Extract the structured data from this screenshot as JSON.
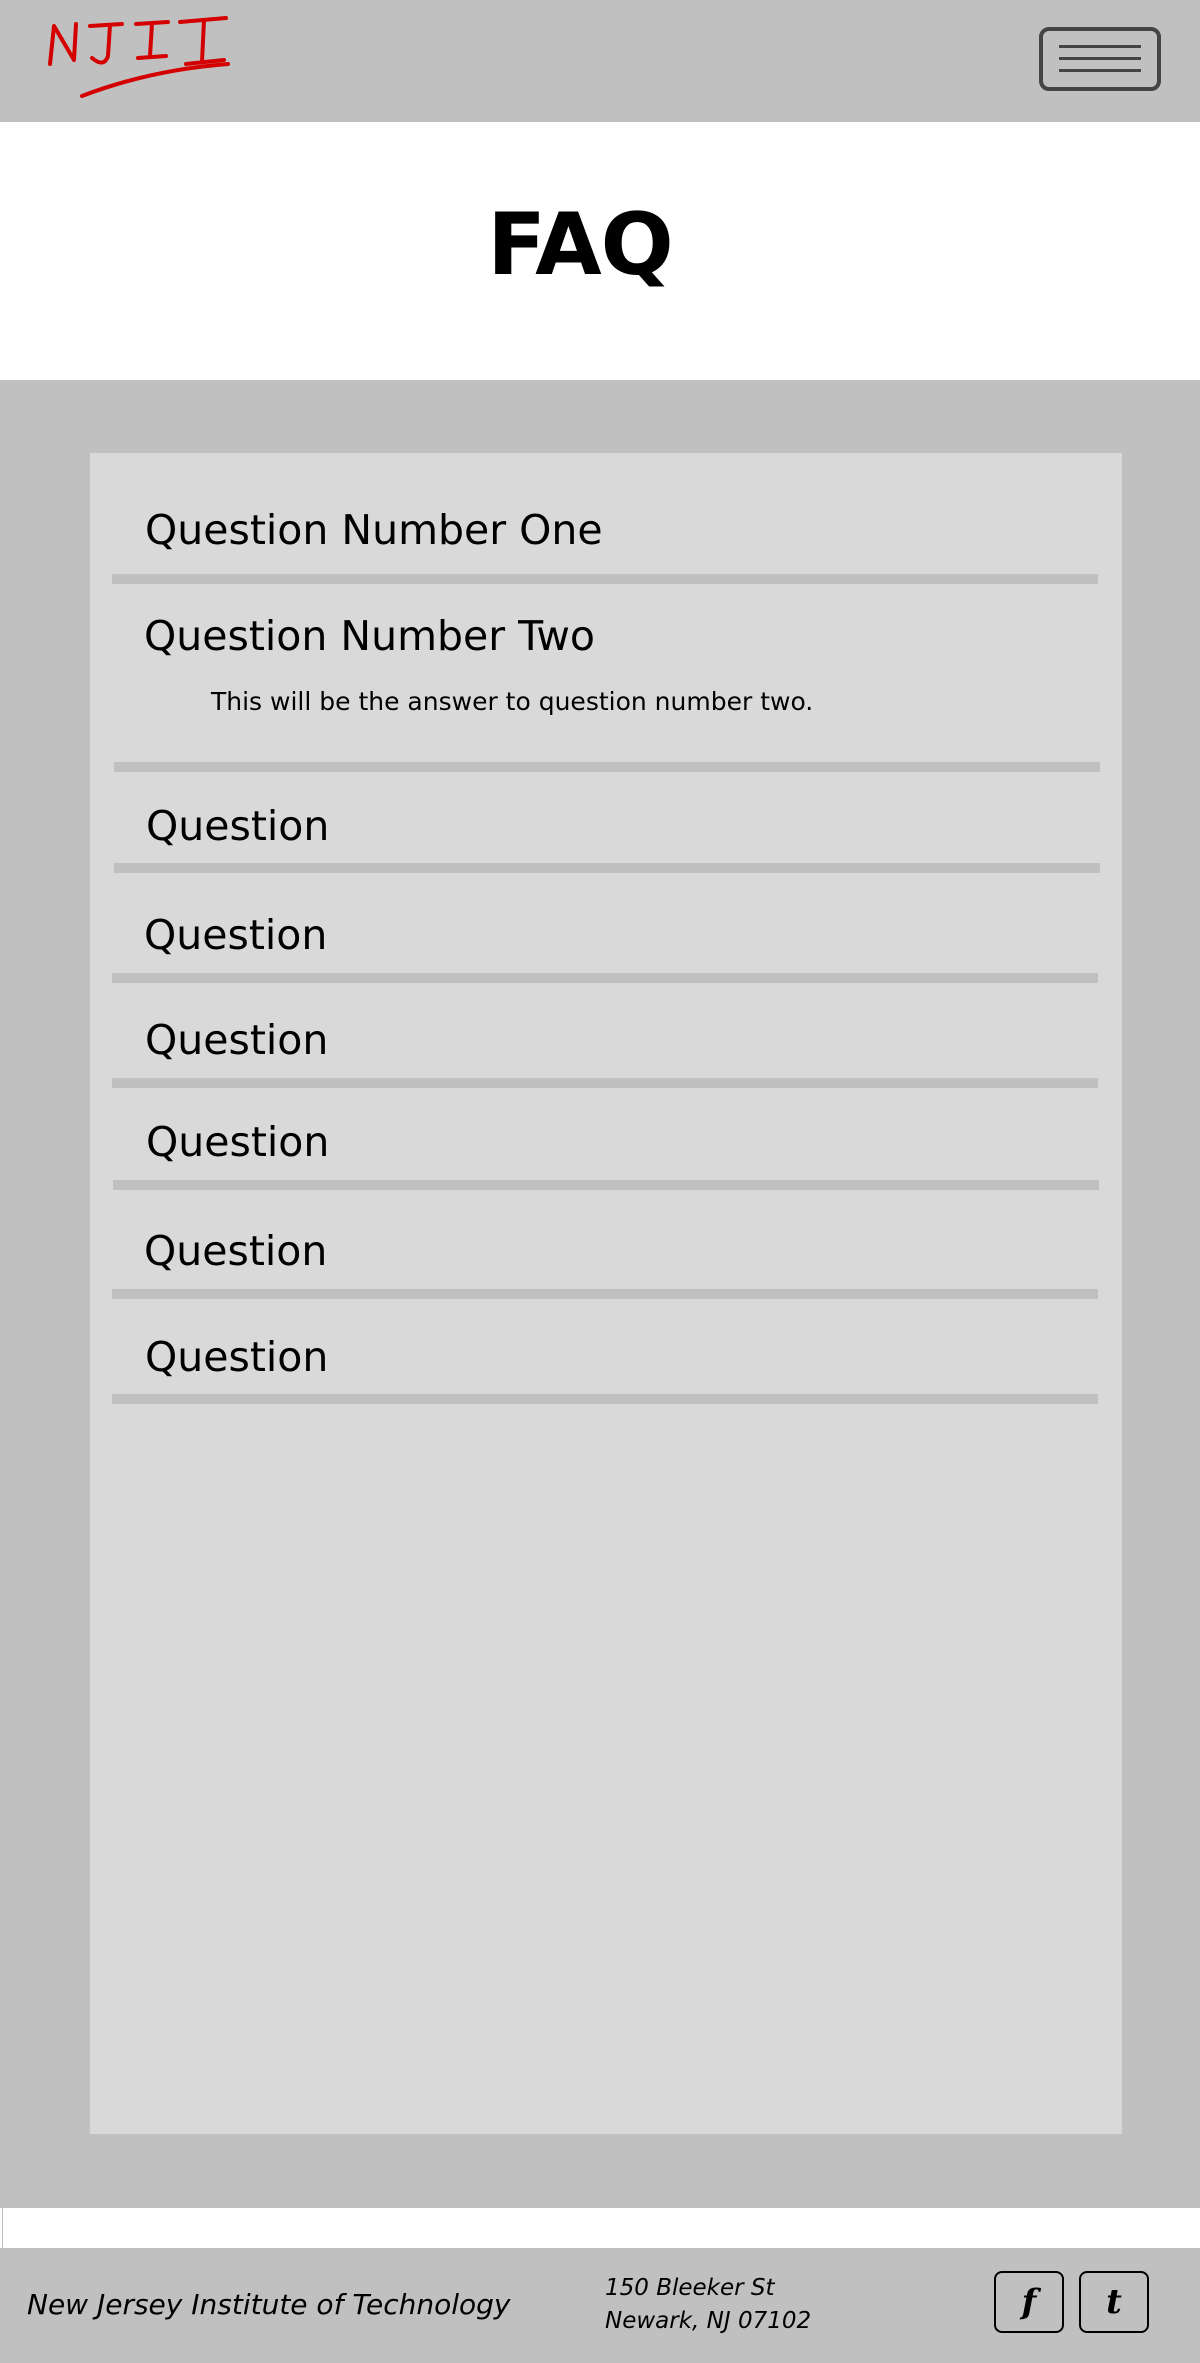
{
  "header": {
    "logo_text": "NJII",
    "brand_color": "#d40000",
    "menu_icon": "hamburger-menu-icon"
  },
  "page": {
    "title": "FAQ"
  },
  "faq": {
    "items": [
      {
        "question": "Question Number One",
        "answer": "",
        "expanded": false
      },
      {
        "question": "Question Number Two",
        "answer": "This will be the answer to question number two.",
        "expanded": true
      },
      {
        "question": "Question",
        "answer": "",
        "expanded": false
      },
      {
        "question": "Question",
        "answer": "",
        "expanded": false
      },
      {
        "question": "Question",
        "answer": "",
        "expanded": false
      },
      {
        "question": "Question",
        "answer": "",
        "expanded": false
      },
      {
        "question": "Question",
        "answer": "",
        "expanded": false
      },
      {
        "question": "Question",
        "answer": "",
        "expanded": false
      }
    ]
  },
  "footer": {
    "org_name": "New Jersey Institute of Technology",
    "address_line1": "150 Bleeker St",
    "address_line2": "Newark, NJ 07102",
    "facebook_label": "f",
    "twitter_label": "t"
  },
  "colors": {
    "chrome_gray": "#c0c0c0",
    "panel_gray": "#d9d9d9",
    "menu_border": "#444444"
  }
}
